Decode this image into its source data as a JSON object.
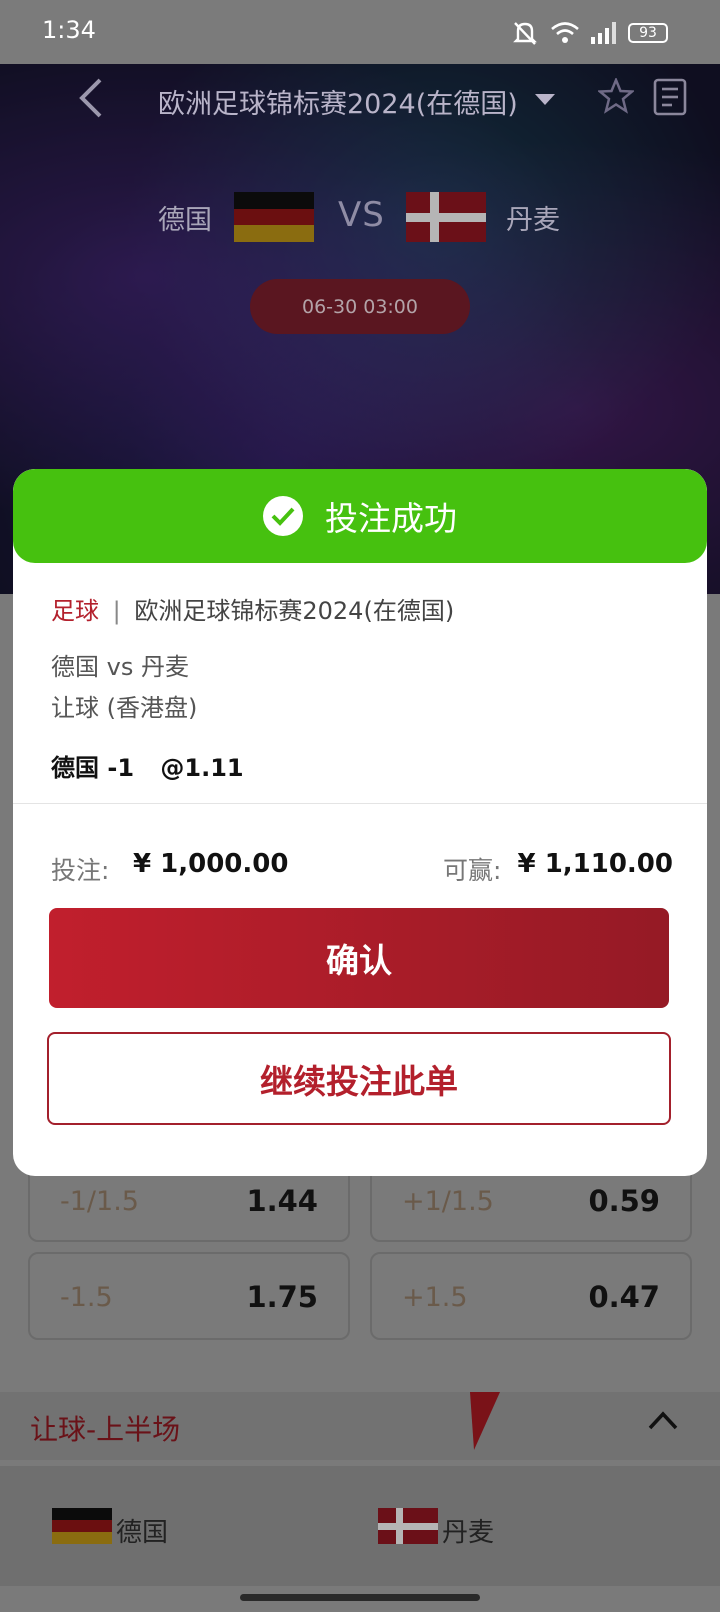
{
  "status_bar": {
    "time": "1:34",
    "battery": "93"
  },
  "header": {
    "title": "欧洲足球锦标赛2024(在德国)"
  },
  "match": {
    "home": "德国",
    "away": "丹麦",
    "vs": "VS",
    "time": "06-30 03:00"
  },
  "modal": {
    "success": "投注成功",
    "sport": "足球",
    "separator": "|",
    "league": "欧洲足球锦标赛2024(在德国)",
    "teams": "德国 vs 丹麦",
    "market": "让球 (香港盘)",
    "selection": "德国 -1",
    "odds": "@1.11",
    "stake_label": "投注:",
    "stake_value": "¥ 1,000.00",
    "win_label": "可赢:",
    "win_value": "¥ 1,110.00",
    "confirm": "确认",
    "continue": "继续投注此单"
  },
  "odds_rows": [
    {
      "left_label": "-1/1.5",
      "left_value": "1.44",
      "right_label": "+1/1.5",
      "right_value": "0.59"
    },
    {
      "left_label": "-1.5",
      "left_value": "1.75",
      "right_label": "+1.5",
      "right_value": "0.47"
    }
  ],
  "section": {
    "title": "让球-上半场"
  },
  "team_row": {
    "home": "德国",
    "away": "丹麦"
  },
  "colors": {
    "accent": "#b3202c",
    "success": "#46c10f"
  }
}
